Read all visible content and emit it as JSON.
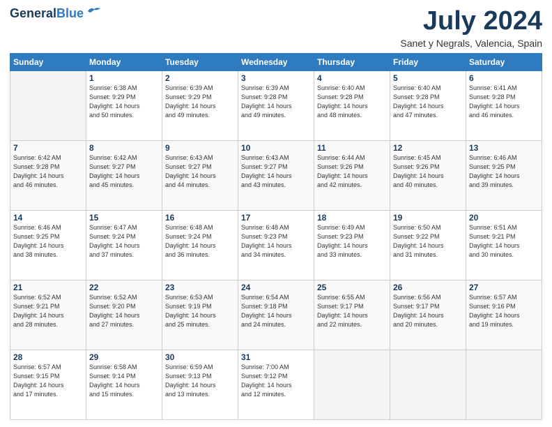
{
  "header": {
    "logo_line1": "General",
    "logo_line2": "Blue",
    "month": "July 2024",
    "location": "Sanet y Negrals, Valencia, Spain"
  },
  "weekdays": [
    "Sunday",
    "Monday",
    "Tuesday",
    "Wednesday",
    "Thursday",
    "Friday",
    "Saturday"
  ],
  "weeks": [
    [
      {
        "day": "",
        "info": ""
      },
      {
        "day": "1",
        "info": "Sunrise: 6:38 AM\nSunset: 9:29 PM\nDaylight: 14 hours\nand 50 minutes."
      },
      {
        "day": "2",
        "info": "Sunrise: 6:39 AM\nSunset: 9:29 PM\nDaylight: 14 hours\nand 49 minutes."
      },
      {
        "day": "3",
        "info": "Sunrise: 6:39 AM\nSunset: 9:28 PM\nDaylight: 14 hours\nand 49 minutes."
      },
      {
        "day": "4",
        "info": "Sunrise: 6:40 AM\nSunset: 9:28 PM\nDaylight: 14 hours\nand 48 minutes."
      },
      {
        "day": "5",
        "info": "Sunrise: 6:40 AM\nSunset: 9:28 PM\nDaylight: 14 hours\nand 47 minutes."
      },
      {
        "day": "6",
        "info": "Sunrise: 6:41 AM\nSunset: 9:28 PM\nDaylight: 14 hours\nand 46 minutes."
      }
    ],
    [
      {
        "day": "7",
        "info": "Sunrise: 6:42 AM\nSunset: 9:28 PM\nDaylight: 14 hours\nand 46 minutes."
      },
      {
        "day": "8",
        "info": "Sunrise: 6:42 AM\nSunset: 9:27 PM\nDaylight: 14 hours\nand 45 minutes."
      },
      {
        "day": "9",
        "info": "Sunrise: 6:43 AM\nSunset: 9:27 PM\nDaylight: 14 hours\nand 44 minutes."
      },
      {
        "day": "10",
        "info": "Sunrise: 6:43 AM\nSunset: 9:27 PM\nDaylight: 14 hours\nand 43 minutes."
      },
      {
        "day": "11",
        "info": "Sunrise: 6:44 AM\nSunset: 9:26 PM\nDaylight: 14 hours\nand 42 minutes."
      },
      {
        "day": "12",
        "info": "Sunrise: 6:45 AM\nSunset: 9:26 PM\nDaylight: 14 hours\nand 40 minutes."
      },
      {
        "day": "13",
        "info": "Sunrise: 6:46 AM\nSunset: 9:25 PM\nDaylight: 14 hours\nand 39 minutes."
      }
    ],
    [
      {
        "day": "14",
        "info": "Sunrise: 6:46 AM\nSunset: 9:25 PM\nDaylight: 14 hours\nand 38 minutes."
      },
      {
        "day": "15",
        "info": "Sunrise: 6:47 AM\nSunset: 9:24 PM\nDaylight: 14 hours\nand 37 minutes."
      },
      {
        "day": "16",
        "info": "Sunrise: 6:48 AM\nSunset: 9:24 PM\nDaylight: 14 hours\nand 36 minutes."
      },
      {
        "day": "17",
        "info": "Sunrise: 6:48 AM\nSunset: 9:23 PM\nDaylight: 14 hours\nand 34 minutes."
      },
      {
        "day": "18",
        "info": "Sunrise: 6:49 AM\nSunset: 9:23 PM\nDaylight: 14 hours\nand 33 minutes."
      },
      {
        "day": "19",
        "info": "Sunrise: 6:50 AM\nSunset: 9:22 PM\nDaylight: 14 hours\nand 31 minutes."
      },
      {
        "day": "20",
        "info": "Sunrise: 6:51 AM\nSunset: 9:21 PM\nDaylight: 14 hours\nand 30 minutes."
      }
    ],
    [
      {
        "day": "21",
        "info": "Sunrise: 6:52 AM\nSunset: 9:21 PM\nDaylight: 14 hours\nand 28 minutes."
      },
      {
        "day": "22",
        "info": "Sunrise: 6:52 AM\nSunset: 9:20 PM\nDaylight: 14 hours\nand 27 minutes."
      },
      {
        "day": "23",
        "info": "Sunrise: 6:53 AM\nSunset: 9:19 PM\nDaylight: 14 hours\nand 25 minutes."
      },
      {
        "day": "24",
        "info": "Sunrise: 6:54 AM\nSunset: 9:18 PM\nDaylight: 14 hours\nand 24 minutes."
      },
      {
        "day": "25",
        "info": "Sunrise: 6:55 AM\nSunset: 9:17 PM\nDaylight: 14 hours\nand 22 minutes."
      },
      {
        "day": "26",
        "info": "Sunrise: 6:56 AM\nSunset: 9:17 PM\nDaylight: 14 hours\nand 20 minutes."
      },
      {
        "day": "27",
        "info": "Sunrise: 6:57 AM\nSunset: 9:16 PM\nDaylight: 14 hours\nand 19 minutes."
      }
    ],
    [
      {
        "day": "28",
        "info": "Sunrise: 6:57 AM\nSunset: 9:15 PM\nDaylight: 14 hours\nand 17 minutes."
      },
      {
        "day": "29",
        "info": "Sunrise: 6:58 AM\nSunset: 9:14 PM\nDaylight: 14 hours\nand 15 minutes."
      },
      {
        "day": "30",
        "info": "Sunrise: 6:59 AM\nSunset: 9:13 PM\nDaylight: 14 hours\nand 13 minutes."
      },
      {
        "day": "31",
        "info": "Sunrise: 7:00 AM\nSunset: 9:12 PM\nDaylight: 14 hours\nand 12 minutes."
      },
      {
        "day": "",
        "info": ""
      },
      {
        "day": "",
        "info": ""
      },
      {
        "day": "",
        "info": ""
      }
    ]
  ]
}
